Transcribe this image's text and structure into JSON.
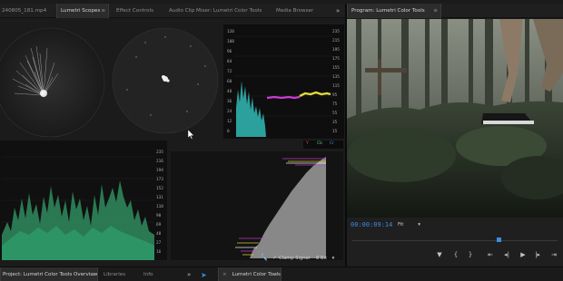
{
  "left_panel": {
    "tabs": [
      {
        "label": "240805_181.mp4"
      },
      {
        "label": "Lumetri Scopes",
        "active": true
      },
      {
        "label": "Effect Controls"
      },
      {
        "label": "Audio Clip Mixer: Lumetri Color Tools"
      },
      {
        "label": "Media Browser"
      }
    ],
    "overflow_label": "»"
  },
  "scopes": {
    "histogram_ticks": [
      "120",
      "108",
      "96",
      "84",
      "72",
      "60",
      "48",
      "36",
      "24",
      "12",
      "0"
    ],
    "histogram_right_ticks": [
      "235",
      "215",
      "195",
      "175",
      "155",
      "135",
      "115",
      "95",
      "75",
      "55",
      "35",
      "15"
    ],
    "waveform_ticks": [
      "235",
      "216",
      "194",
      "173",
      "152",
      "131",
      "110",
      "90",
      "69",
      "48",
      "27",
      "16"
    ],
    "parade_labels": [
      "Y",
      "Cb",
      "Cr"
    ],
    "clamp_signal_label": "Clamp Signal",
    "clamp_signal_checked": true,
    "bit_depth": "8 Bit"
  },
  "program_panel": {
    "title": "Program: Lumetri Color Tools",
    "timecode": "00:00:09:14",
    "fit_label": "Fit",
    "playhead_fraction": 0.72
  },
  "bottom": {
    "project_tab": "Project: Lumetri Color Tools Overview",
    "libraries_tab": "Libraries",
    "info_tab": "Info",
    "timeline_tab": "Lumetri Color Tools"
  },
  "colors": {
    "accent_blue": "#3d8be0",
    "waveform_green": "#3fd08a",
    "histogram_cyan": "#35c6c0",
    "histogram_magenta": "#cf3bd3",
    "histogram_yellow": "#e3d93a"
  }
}
